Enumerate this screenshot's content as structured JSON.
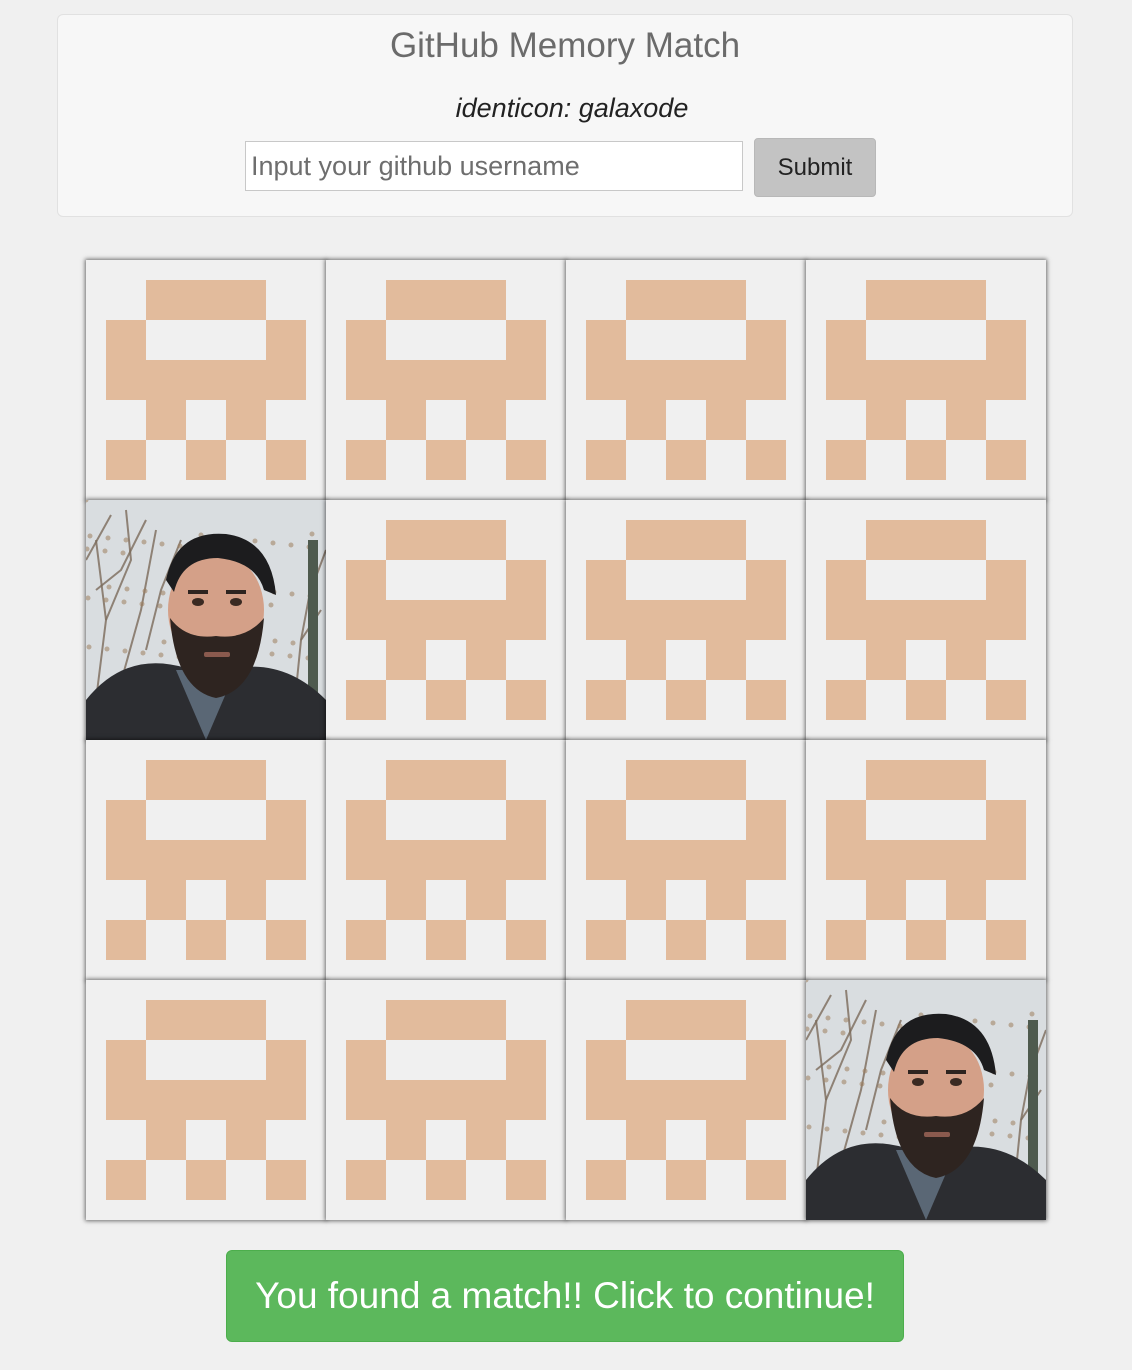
{
  "header": {
    "title": "GitHub Memory Match",
    "identicon_label": "identicon: galaxode",
    "input_placeholder": "Input your github username",
    "input_value": "",
    "submit_label": "Submit"
  },
  "theme": {
    "identicon_color": "#e2bb9c",
    "card_background": "#f0f0f0",
    "success_color": "#5cb85c"
  },
  "board": {
    "columns": 4,
    "rows": 4,
    "cards": [
      {
        "state": "hidden",
        "face": "identicon"
      },
      {
        "state": "hidden",
        "face": "identicon"
      },
      {
        "state": "hidden",
        "face": "identicon"
      },
      {
        "state": "hidden",
        "face": "identicon"
      },
      {
        "state": "revealed",
        "face": "avatar-photo"
      },
      {
        "state": "hidden",
        "face": "identicon"
      },
      {
        "state": "hidden",
        "face": "identicon"
      },
      {
        "state": "hidden",
        "face": "identicon"
      },
      {
        "state": "hidden",
        "face": "identicon"
      },
      {
        "state": "hidden",
        "face": "identicon"
      },
      {
        "state": "hidden",
        "face": "identicon"
      },
      {
        "state": "hidden",
        "face": "identicon"
      },
      {
        "state": "hidden",
        "face": "identicon"
      },
      {
        "state": "hidden",
        "face": "identicon"
      },
      {
        "state": "hidden",
        "face": "identicon"
      },
      {
        "state": "revealed",
        "face": "avatar-photo"
      }
    ]
  },
  "status": {
    "continue_label": "You found a match!! Click to continue!"
  }
}
